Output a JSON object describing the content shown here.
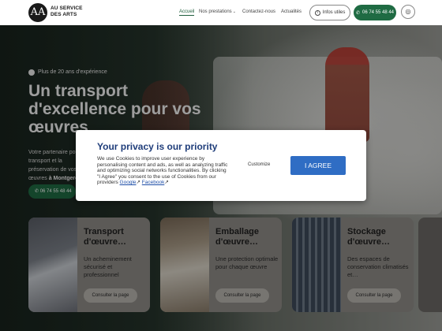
{
  "header": {
    "brand_line1": "AU SERVICE",
    "brand_line2": "DES ARTS",
    "logo_text": "AA",
    "nav": [
      {
        "label": "Accueil",
        "active": true
      },
      {
        "label": "Nos prestations",
        "has_dropdown": true
      },
      {
        "label": "Contactez-nous"
      },
      {
        "label": "Actualités"
      }
    ],
    "info_button": "Infos utiles",
    "phone_button": "06 74 55 48 44",
    "icons": {
      "info": "info-icon",
      "phone": "phone-icon",
      "globe": "globe-icon"
    }
  },
  "hero": {
    "badge": "Plus de 20 ans d'expérience",
    "title": "Un transport d'excellence pour vos œuvres",
    "text_prefix": "Votre partenaire pour le transport et la préservation de vos œuvres",
    "text_location": "à Montgeron.",
    "phone": "06 74 55 48 44"
  },
  "cards": [
    {
      "title": "Transport d'œuvre…",
      "description": "Un acheminement sécurisé et professionnel",
      "button": "Consulter la page"
    },
    {
      "title": "Emballage d'œuvre…",
      "description": "Une protection optimale pour chaque œuvre",
      "button": "Consulter la page"
    },
    {
      "title": "Stockage d'œuvre…",
      "description": "Des espaces de conservation climatisés et…",
      "button": "Consulter la page"
    }
  ],
  "consent": {
    "title": "Your privacy is our priority",
    "body": "We use Cookies to improve user experience by personalising content and ads, as well as analyzing traffic and optimizing social networks functionalities. By clicking \"I Agree\" you consent to the use of Cookies from our providers",
    "link_google": "Google",
    "link_facebook": "Facebook",
    "customize": "Customize",
    "agree": "I AGREE"
  },
  "colors": {
    "brand_green": "#1f6b43",
    "consent_title": "#1f3d7a",
    "agree_button": "#2f6dc4"
  }
}
